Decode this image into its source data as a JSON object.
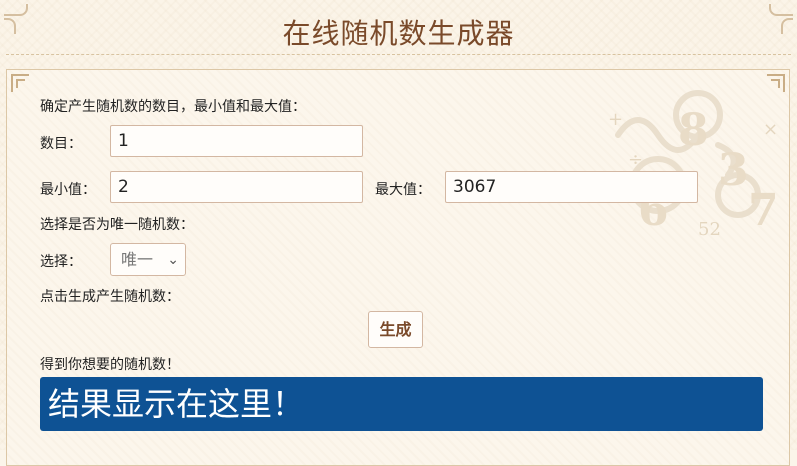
{
  "header": {
    "title": "在线随机数生成器"
  },
  "form": {
    "intro": "确定产生随机数的数目，最小值和最大值：",
    "count_label": "数目：",
    "count_value": "1",
    "min_label": "最小值：",
    "min_value": "2",
    "max_label": "最大值：",
    "max_value": "3067",
    "unique_prompt": "选择是否为唯一随机数：",
    "choice_label": "选择：",
    "choice_selected": "唯一",
    "generate_prompt": "点击生成产生随机数：",
    "generate_button": "生成",
    "result_prompt": "得到你想要的随机数！",
    "result_text": "结果显示在这里！"
  },
  "colors": {
    "title": "#7a4a2a",
    "result_bg": "#0e5294",
    "border": "#d3b7a2",
    "background": "#fbf4e8"
  },
  "icons": {
    "select_arrow": "chevron-down-icon"
  }
}
